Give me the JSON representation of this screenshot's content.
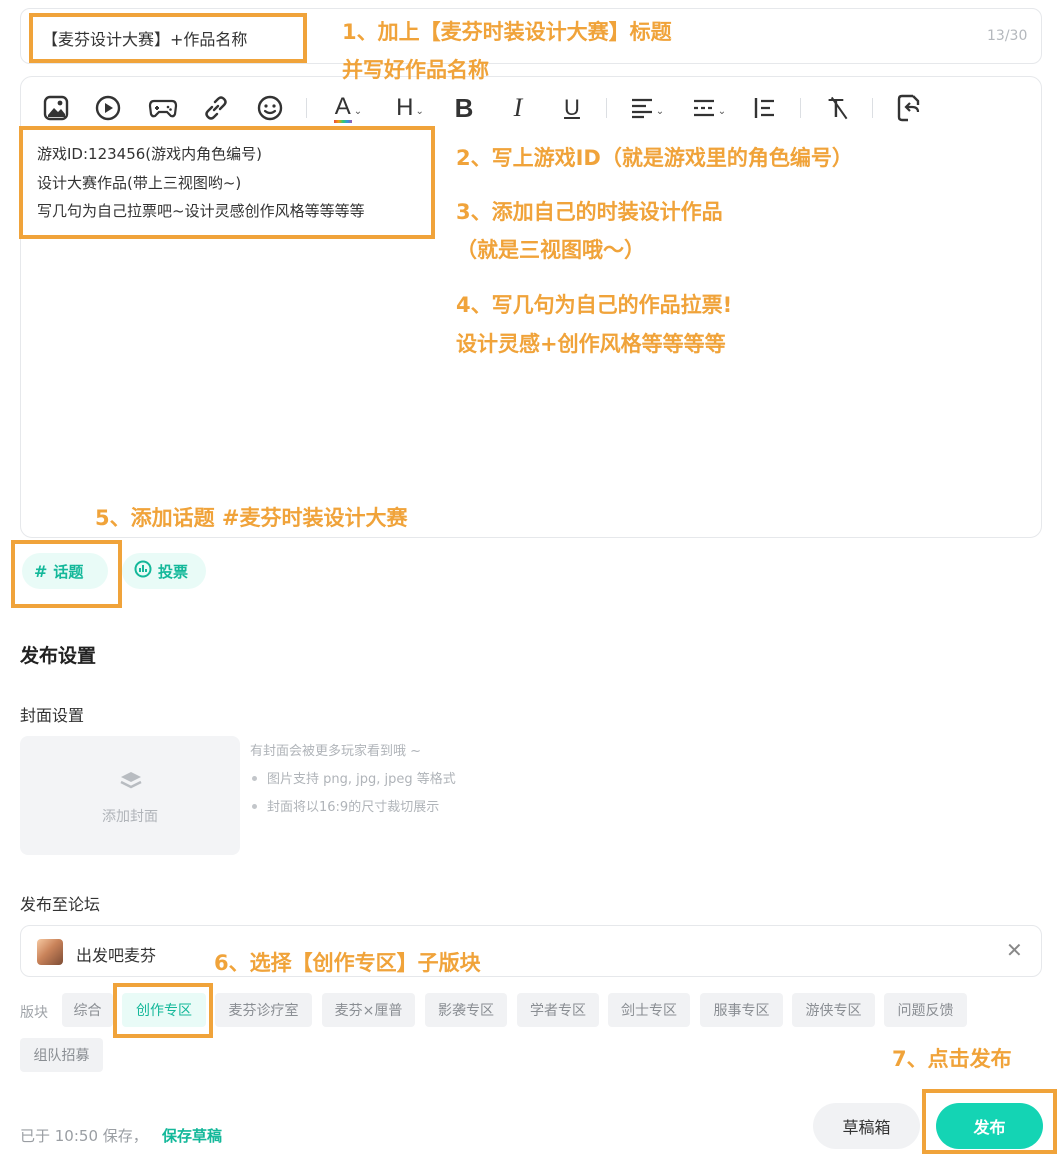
{
  "title_field": {
    "value": "【麦芬设计大赛】+作品名称",
    "count": "13/30"
  },
  "toolbar": {
    "icons": [
      "image-icon",
      "video-icon",
      "game-icon",
      "link-icon",
      "emoji-icon",
      "font-color-icon",
      "heading-icon",
      "bold-icon",
      "italic-icon",
      "underline-icon",
      "align-icon",
      "divider-icon",
      "list-icon",
      "clear-format-icon",
      "undo-icon"
    ],
    "font_color_label": "A",
    "heading_label": "H",
    "bold_label": "B",
    "italic_label": "I",
    "underline_label": "U",
    "clear_label": "T",
    "caret": "⌄"
  },
  "editor_body": {
    "lines": [
      "游戏ID:123456(游戏内角色编号)",
      "设计大赛作品(带上三视图哟~)",
      "写几句为自己拉票吧~设计灵感创作风格等等等等"
    ]
  },
  "chips": {
    "topic_icon": "#",
    "topic": "话题",
    "vote": "投票"
  },
  "publish_settings": {
    "title": "发布设置",
    "cover_label": "封面设置",
    "cover_add": "添加封面",
    "cover_hints": [
      "有封面会被更多玩家看到哦 ~",
      "图片支持 png, jpg, jpeg 等格式",
      "封面将以16:9的尺寸裁切展示"
    ],
    "forum_label": "发布至论坛",
    "forum_name": "出发吧麦芬",
    "close_icon": "✕",
    "tags_label": "版块",
    "tags": [
      "综合",
      "创作专区",
      "麦芬诊疗室",
      "麦芬×厘普",
      "影袭专区",
      "学者专区",
      "剑士专区",
      "服事专区",
      "游侠专区",
      "问题反馈",
      "组队招募"
    ],
    "active_tag": "创作专区"
  },
  "footer": {
    "saved_text": "已于 10:50 保存，",
    "save_draft": "保存草稿",
    "draft_box": "草稿箱",
    "publish": "发布"
  },
  "annotations": {
    "a1_line1": "1、加上【麦芬时装设计大赛】标题",
    "a1_line2": "并写好作品名称",
    "a2": "2、写上游戏ID（就是游戏里的角色编号）",
    "a3_line1": "3、添加自己的时装设计作品",
    "a3_line2": "（就是三视图哦～）",
    "a4_line1": "4、写几句为自己的作品拉票!",
    "a4_line2": "设计灵感+创作风格等等等等",
    "a5": "5、添加话题 #麦芬时装设计大赛",
    "a6": "6、选择【创作专区】子版块",
    "a7": "7、点击发布"
  },
  "colors": {
    "accent": "#14d4b4",
    "accent_text": "#14b89a",
    "annotation": "#f0a33a"
  }
}
